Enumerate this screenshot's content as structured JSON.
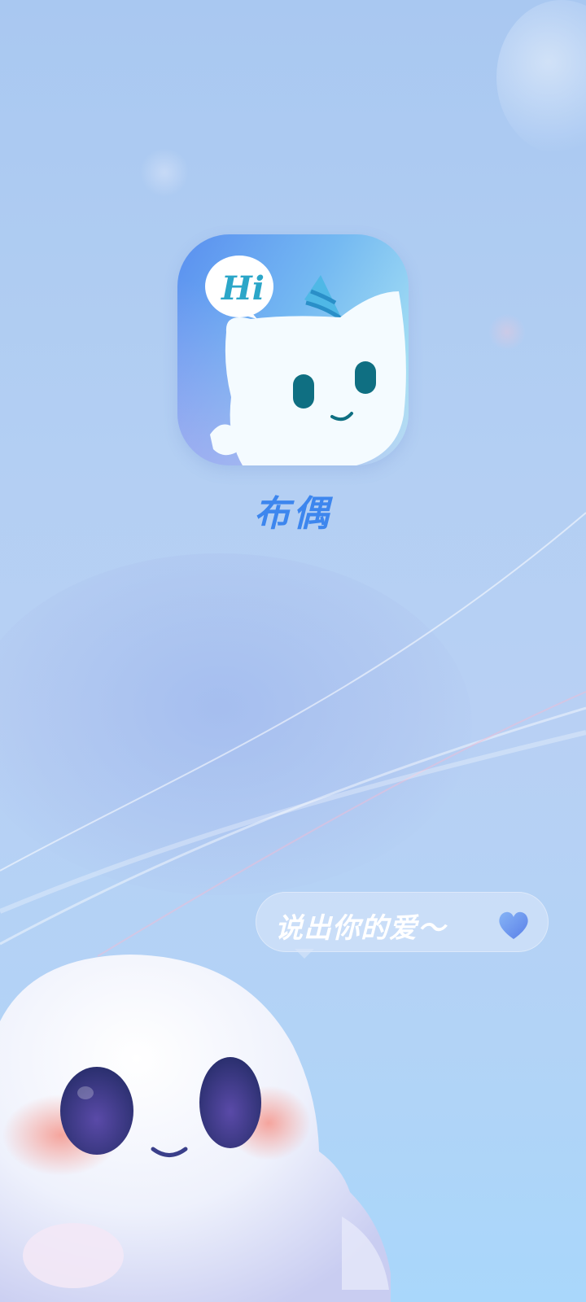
{
  "splash": {
    "app_icon": {
      "name": "app-icon-ghost-mascot",
      "bubble_text": "Hi"
    },
    "app_name": "布偶",
    "speech_bubble": {
      "text": "说出你的爱～",
      "icon": "heart-icon"
    },
    "mascot": "ghost-mascot"
  },
  "colors": {
    "brand_blue": "#3d86ee",
    "background_top": "#a9c8f1",
    "background_bottom": "#a9d7fb",
    "heart": "#6a8ff0"
  }
}
